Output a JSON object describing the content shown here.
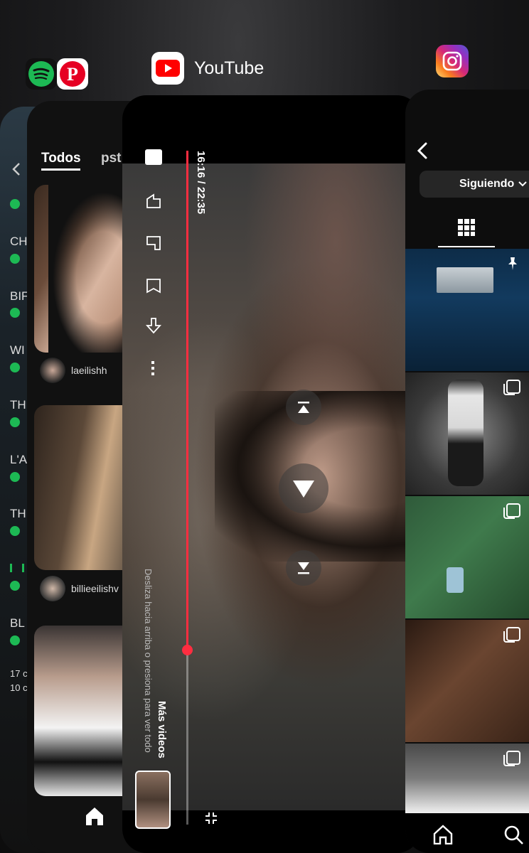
{
  "app_switcher": {
    "youtube": {
      "name": "YouTube"
    }
  },
  "spotify_card": {
    "rows": [
      "CH",
      "BIF",
      "WI",
      "TH",
      "L'A",
      "TH",
      "BL"
    ],
    "footer_lines": [
      "17 c",
      "10 c"
    ]
  },
  "pinterest_card": {
    "tab_active": "Todos",
    "tab_next": "pst",
    "users": [
      "laeilishh",
      "billieeilishv"
    ]
  },
  "youtube_card": {
    "time": "16:16 / 22:35",
    "more_videos_title": "Más videos",
    "more_videos_hint": "Desliza hacia arriba o presiona para ver todo",
    "progress": 0.74
  },
  "instagram_card": {
    "dropdown_label": "Siguiendo"
  },
  "colors": {
    "youtube_red": "#ff0000",
    "spotify_green": "#1db954",
    "pinterest_red": "#e60023",
    "progress_red": "#ff2d40"
  }
}
